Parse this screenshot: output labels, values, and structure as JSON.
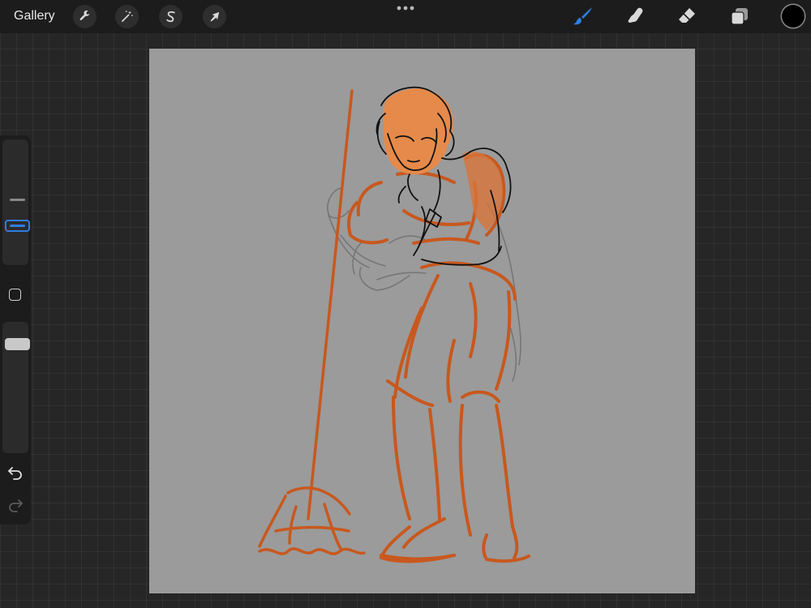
{
  "topbar": {
    "gallery_label": "Gallery",
    "left_tools": [
      {
        "name": "actions",
        "icon": "wrench-icon"
      },
      {
        "name": "adjustments",
        "icon": "magic-wand-icon"
      },
      {
        "name": "selection",
        "icon": "selection-s-icon"
      },
      {
        "name": "transform",
        "icon": "arrow-cursor-icon"
      }
    ],
    "right_tools": [
      {
        "name": "paint",
        "icon": "brush-icon",
        "active": true
      },
      {
        "name": "smudge",
        "icon": "smudge-finger-icon",
        "active": false
      },
      {
        "name": "eraser",
        "icon": "eraser-icon",
        "active": false
      },
      {
        "name": "layers",
        "icon": "layers-icon",
        "active": false
      }
    ],
    "current_color": "#000000"
  },
  "sidebar": {
    "brush_size_level": 0.27,
    "opacity_level": 0.9,
    "accent": "#2f7de1"
  },
  "canvas": {
    "background": "#9b9b9b",
    "stroke_colors": {
      "sketch": "#7a7a7a",
      "orange": "#c8581e",
      "skin": "#e58a4a",
      "line": "#111111"
    }
  }
}
